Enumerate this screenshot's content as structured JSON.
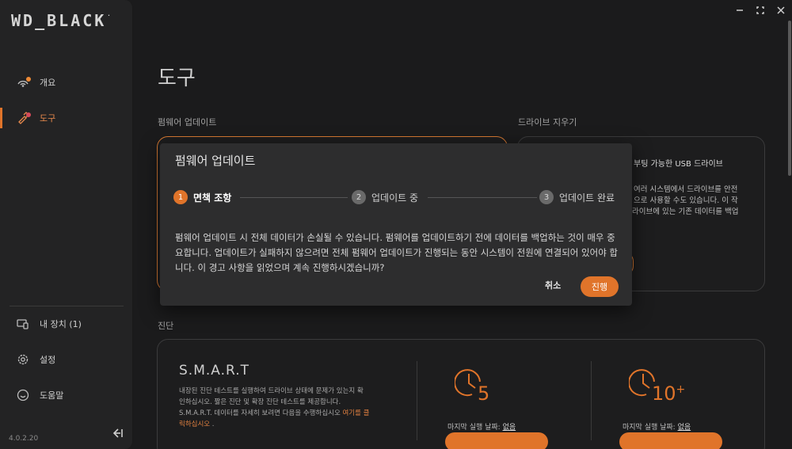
{
  "app": {
    "logo": "WD_BLACK",
    "logo_tm": "."
  },
  "sidebar": {
    "items": [
      {
        "label": "개요",
        "icon": "overview-icon"
      },
      {
        "label": "도구",
        "icon": "tools-icon"
      },
      {
        "label": "내 장치 (1)",
        "icon": "devices-icon"
      },
      {
        "label": "설정",
        "icon": "settings-icon"
      },
      {
        "label": "도움말",
        "icon": "help-icon"
      }
    ],
    "active_index": 1,
    "version": "4.0.2.20"
  },
  "page": {
    "title": "도구",
    "firmware_section": "펌웨어 업데이트",
    "erase_section": "드라이브 지우기",
    "diag_section": "진단"
  },
  "erase_card": {
    "heading": "부팅 가능한 USB 드라이브",
    "line1": "여러 시스템에서 드라이브를 안전",
    "line2": "으로 사용할 수도 있습니다. 이 작",
    "line3": "라이브에 있는 기존 데이터를 백업"
  },
  "diagnostics": {
    "title": "S.M.A.R.T",
    "desc1": "내장된 진단 테스트를 실행하여 드라이브 상태에 문제가 있는지 확",
    "desc2": "인하십시오. 짧은 진단 및 확장 진단 테스트를 제공합니다.",
    "desc3": "S.M.A.R.T. 데이터를 자세히 보려면 다음을 수행하십시오 ",
    "link": "여기를 클",
    "link2": "릭하십시오",
    "desc4": " .",
    "short_test": {
      "number": "5",
      "last_run_label": "마지막 실행 날짜: ",
      "last_run_value": "없음"
    },
    "extended_test": {
      "number": "10",
      "sup": "+",
      "last_run_label": "마지막 실행 날짜: ",
      "last_run_value": "없음"
    }
  },
  "modal": {
    "title": "펌웨어 업데이트",
    "steps": [
      {
        "num": "1",
        "label": "면책 조항"
      },
      {
        "num": "2",
        "label": "업데이트 중"
      },
      {
        "num": "3",
        "label": "업데이트 완료"
      }
    ],
    "active_step": 0,
    "body": "펌웨어 업데이트 시 전체 데이터가 손실될 수 있습니다. 펌웨어를 업데이트하기 전에 데이터를 백업하는 것이 매우 중요합니다. 업데이트가 실패하지 않으려면 전체 펌웨어 업데이트가 진행되는 동안 시스템이 전원에 연결되어 있어야 합니다. 이 경고 사항을 읽었으며 계속 진행하시겠습니까?",
    "cancel_label": "취소",
    "proceed_label": "진행"
  },
  "colors": {
    "accent": "#e0742a",
    "background": "#1b1b1c",
    "sidebar": "#232324",
    "modal": "#2d2d2e"
  }
}
